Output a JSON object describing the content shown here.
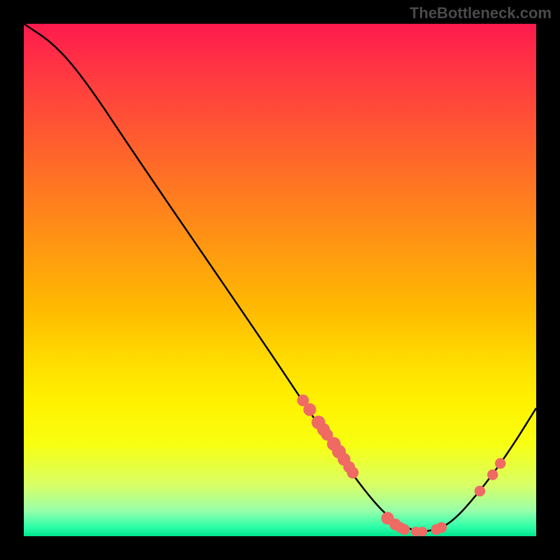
{
  "watermark": "TheBottleneck.com",
  "chart_data": {
    "type": "line",
    "title": "",
    "xlabel": "",
    "ylabel": "",
    "xlim": [
      0,
      100
    ],
    "ylim": [
      0,
      100
    ],
    "curve": [
      {
        "x": 0,
        "y": 100
      },
      {
        "x": 6,
        "y": 96
      },
      {
        "x": 12,
        "y": 89
      },
      {
        "x": 22,
        "y": 74
      },
      {
        "x": 35,
        "y": 55
      },
      {
        "x": 48,
        "y": 36
      },
      {
        "x": 56,
        "y": 24
      },
      {
        "x": 62,
        "y": 15
      },
      {
        "x": 68,
        "y": 7
      },
      {
        "x": 72,
        "y": 3
      },
      {
        "x": 76,
        "y": 1
      },
      {
        "x": 80,
        "y": 1
      },
      {
        "x": 84,
        "y": 3
      },
      {
        "x": 90,
        "y": 10
      },
      {
        "x": 95,
        "y": 17
      },
      {
        "x": 100,
        "y": 25
      }
    ],
    "points_on_curve": [
      {
        "x": 54.5,
        "y": 26.5,
        "r": 1.2
      },
      {
        "x": 55.8,
        "y": 24.7,
        "r": 1.3
      },
      {
        "x": 57.5,
        "y": 22.2,
        "r": 1.4
      },
      {
        "x": 58.5,
        "y": 20.8,
        "r": 1.3
      },
      {
        "x": 59.2,
        "y": 19.8,
        "r": 1.2
      },
      {
        "x": 60.5,
        "y": 18.0,
        "r": 1.4
      },
      {
        "x": 61.5,
        "y": 16.5,
        "r": 1.4
      },
      {
        "x": 62.5,
        "y": 15.0,
        "r": 1.3
      },
      {
        "x": 63.5,
        "y": 13.5,
        "r": 1.2
      },
      {
        "x": 64.2,
        "y": 12.4,
        "r": 1.2
      },
      {
        "x": 71.0,
        "y": 3.5,
        "r": 1.3
      },
      {
        "x": 72.5,
        "y": 2.3,
        "r": 1.2
      },
      {
        "x": 73.5,
        "y": 1.7,
        "r": 1.1
      },
      {
        "x": 74.3,
        "y": 1.3,
        "r": 1.1
      },
      {
        "x": 76.5,
        "y": 0.9,
        "r": 1.0
      },
      {
        "x": 77.8,
        "y": 0.9,
        "r": 1.0
      },
      {
        "x": 80.5,
        "y": 1.3,
        "r": 1.1
      },
      {
        "x": 81.5,
        "y": 1.7,
        "r": 1.1
      },
      {
        "x": 89.0,
        "y": 8.8,
        "r": 1.1
      },
      {
        "x": 91.5,
        "y": 12.0,
        "r": 1.1
      },
      {
        "x": 93.0,
        "y": 14.2,
        "r": 1.1
      }
    ]
  }
}
